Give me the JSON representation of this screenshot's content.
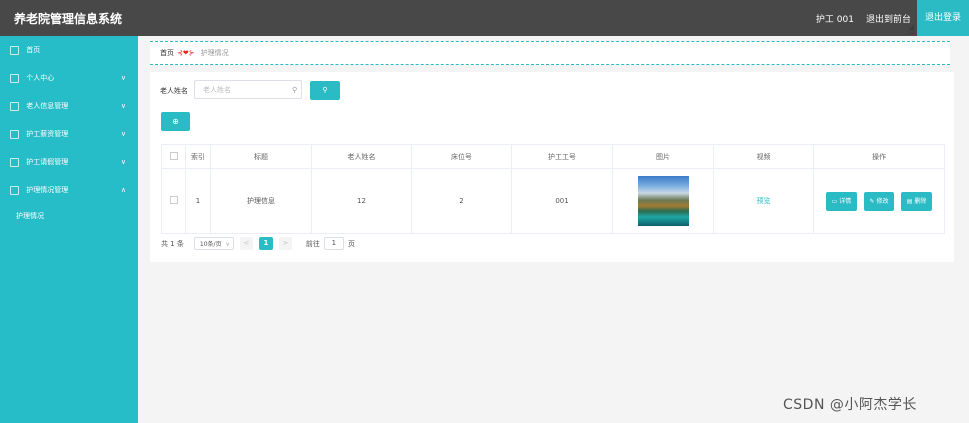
{
  "header": {
    "title": "养老院管理信息系统",
    "user": "护工 001",
    "exit_backend": "退出到前台",
    "logout": "退出登录"
  },
  "sidebar": {
    "items": [
      {
        "label": "首页",
        "chevron": ""
      },
      {
        "label": "个人中心",
        "chevron": "∨"
      },
      {
        "label": "老人信息管理",
        "chevron": "∨"
      },
      {
        "label": "护工薪资管理",
        "chevron": "∨"
      },
      {
        "label": "护工请假管理",
        "chevron": "∨"
      },
      {
        "label": "护理情况管理",
        "chevron": "∧"
      }
    ],
    "subitems": [
      {
        "label": "护理情况"
      }
    ]
  },
  "breadcrumb": {
    "home": "首页",
    "sep_left": "⊰",
    "heart": "❤",
    "sep_right": "⊱",
    "current": "护理情况"
  },
  "search": {
    "label": "老人姓名",
    "placeholder": "老人姓名",
    "search_icon": "search-icon",
    "button_icon": "search-icon"
  },
  "toolbar": {
    "add_icon": "plus-icon",
    "add_glyph": "⊕"
  },
  "table": {
    "headers": [
      "",
      "索引",
      "标题",
      "老人姓名",
      "床位号",
      "护工工号",
      "图片",
      "视频",
      "操作"
    ],
    "rows": [
      {
        "index": "1",
        "title": "护理信息",
        "elder_name": "12",
        "bed_no": "2",
        "worker_no": "001",
        "video": "预览",
        "actions": [
          "详情",
          "修改",
          "删除"
        ]
      }
    ]
  },
  "pagination": {
    "total": "共 1 条",
    "page_size": "10条/页",
    "prev": "<",
    "current": "1",
    "next": ">",
    "goto": "前往",
    "goto_value": "1",
    "page_suffix": "页"
  },
  "watermark": "CSDN @小阿杰学长",
  "colors": {
    "accent": "#2bbbc5",
    "sidebar": "#26bdc8",
    "topbar": "#484848"
  }
}
